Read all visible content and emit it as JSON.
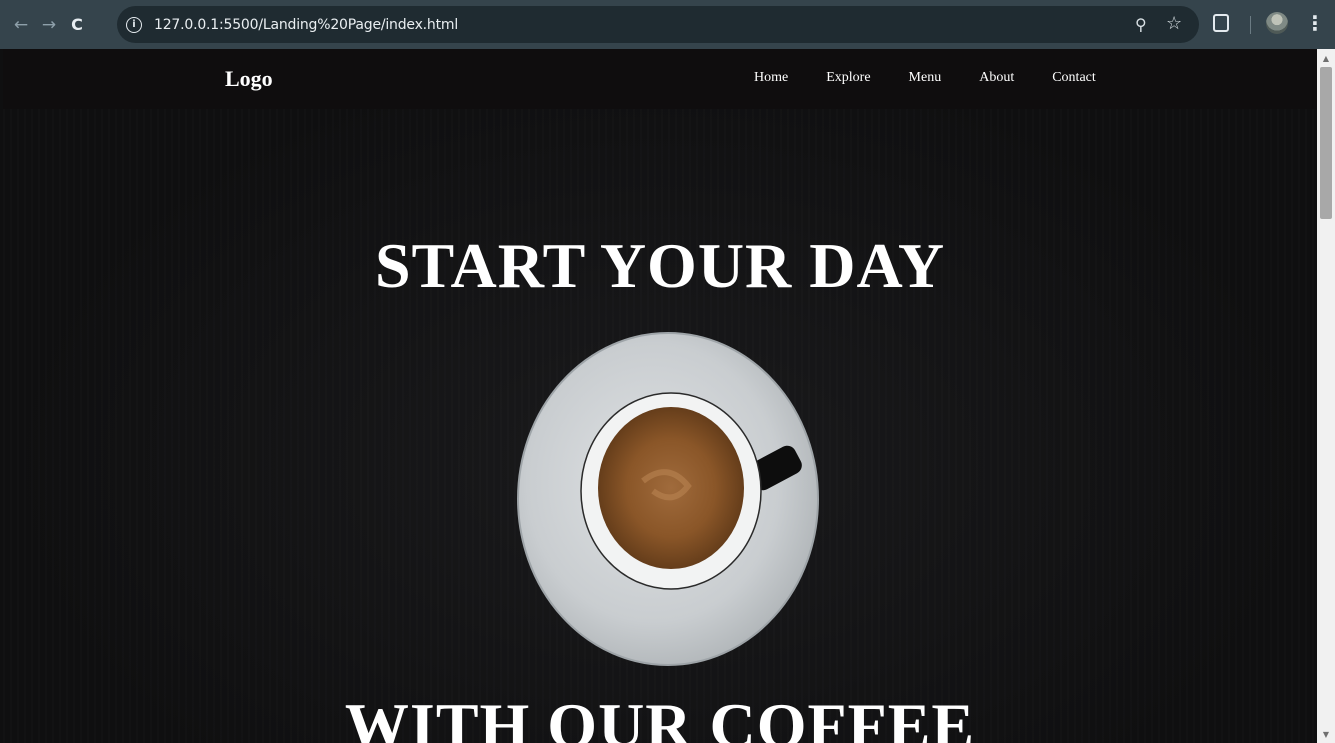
{
  "browser": {
    "url": "127.0.0.1:5500/Landing%20Page/index.html",
    "icons": {
      "back": "arrow-left-icon",
      "forward": "arrow-right-icon",
      "reload": "reload-icon",
      "site_info": "info-icon",
      "zoom": "zoom-icon",
      "bookmark": "star-icon",
      "extensions": "puzzle-icon",
      "profile": "avatar",
      "menu": "kebab-menu-icon"
    }
  },
  "site": {
    "logo": "Logo",
    "nav": [
      {
        "label": "Home"
      },
      {
        "label": "Explore"
      },
      {
        "label": "Menu"
      },
      {
        "label": "About"
      },
      {
        "label": "Contact"
      }
    ],
    "hero": {
      "title_top": "START YOUR DAY",
      "title_bottom": "WITH OUR COFFEE"
    }
  },
  "colors": {
    "chrome_bg": "#35444c",
    "omnibox_bg": "#1f2b31",
    "page_bg": "#0f0f10",
    "text": "#ffffff"
  }
}
